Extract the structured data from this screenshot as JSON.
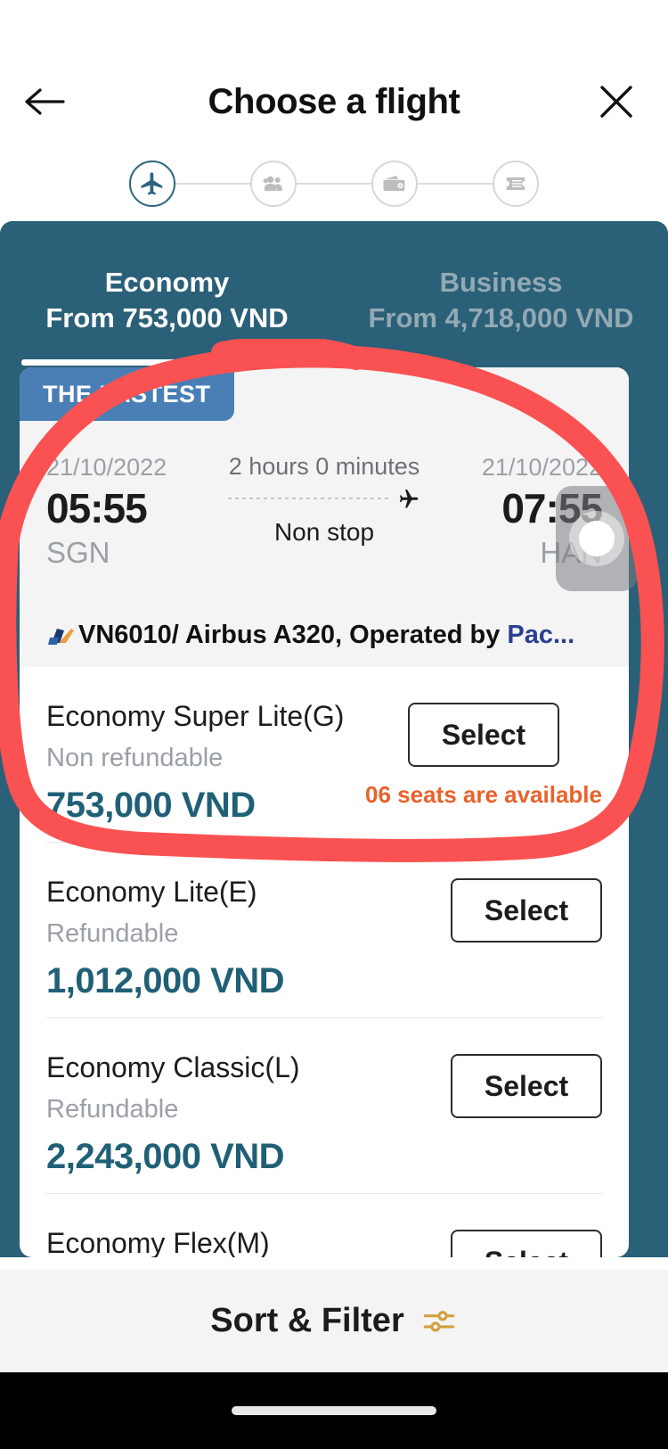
{
  "header": {
    "title": "Choose a flight",
    "back_icon": "arrow-left-icon",
    "close_icon": "close-icon"
  },
  "stepper": {
    "steps": [
      {
        "icon": "airplane-icon",
        "active": true
      },
      {
        "icon": "passengers-icon",
        "active": false
      },
      {
        "icon": "wallet-icon",
        "active": false
      },
      {
        "icon": "ticket-icon",
        "active": false
      }
    ]
  },
  "tabs": [
    {
      "name": "Economy",
      "price": "From 753,000 VND",
      "active": true
    },
    {
      "name": "Business",
      "price": "From 4,718,000 VND",
      "active": false
    }
  ],
  "flight": {
    "badge": "THE FASTEST",
    "depart": {
      "date": "21/10/2022",
      "time": "05:55",
      "code": "SGN"
    },
    "arrive": {
      "date": "21/10/2022",
      "time": "07:55",
      "code": "HAN"
    },
    "duration": "2 hours 0 minutes",
    "stops": "Non stop",
    "airline_logo": "vietnam-airlines-lotus-icon",
    "airline_text": "VN6010/ Airbus A320, Operated by ",
    "airline_operator": "Pac..."
  },
  "fares": [
    {
      "name": "Economy Super Lite(G)",
      "refund": "Non refundable",
      "price": "753,000 VND",
      "select_label": "Select",
      "seats": "06 seats are available"
    },
    {
      "name": "Economy Lite(E)",
      "refund": "Refundable",
      "price": "1,012,000 VND",
      "select_label": "Select",
      "seats": ""
    },
    {
      "name": "Economy Classic(L)",
      "refund": "Refundable",
      "price": "2,243,000 VND",
      "select_label": "Select",
      "seats": ""
    },
    {
      "name": "Economy Flex(M)",
      "refund": "",
      "price": "",
      "select_label": "Select",
      "seats": ""
    }
  ],
  "bottom": {
    "sort_filter_label": "Sort & Filter",
    "filter_icon": "sliders-icon"
  },
  "annotation": {
    "type": "hand-drawn-circle",
    "color": "#fa5252"
  },
  "colors": {
    "teal": "#2a6078",
    "badge_blue": "#4a7fb5",
    "price_teal": "#1f6077",
    "seats_orange": "#e8622b",
    "operator_blue": "#2d3f8f"
  }
}
